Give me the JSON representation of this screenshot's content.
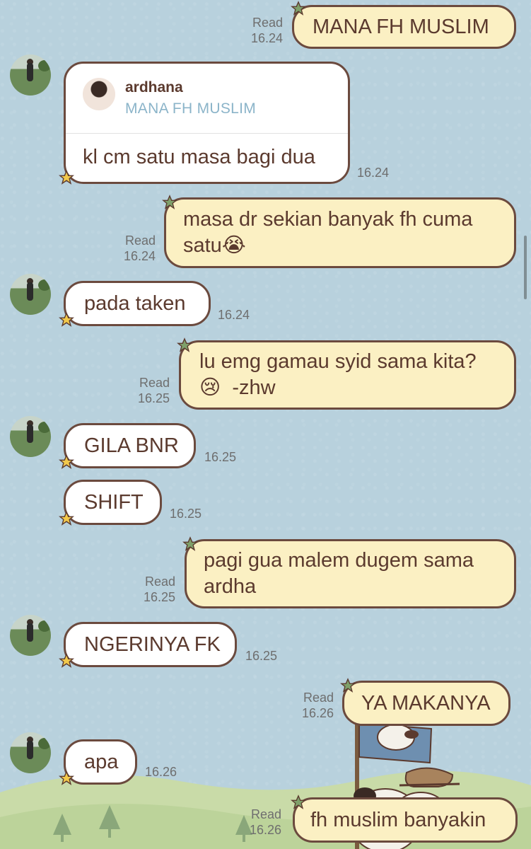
{
  "colors": {
    "background": "#b8d1dd",
    "incoming_bubble": "#ffffff",
    "outgoing_bubble": "#fbf0c3",
    "bubble_border": "#6b4a3e",
    "text": "#5b3a2e",
    "reply_quote": "#8bb4c9"
  },
  "read_label": "Read",
  "messages": [
    {
      "side": "out",
      "text": "MANA FH MUSLIM",
      "read": "Read",
      "time": "16.24"
    },
    {
      "side": "in",
      "reply": {
        "name": "ardhana",
        "quote": "MANA FH MUSLIM"
      },
      "text": "kl cm satu masa bagi dua",
      "time": "16.24"
    },
    {
      "side": "out",
      "text": "masa dr sekian banyak fh cuma\nsatu😭",
      "read": "Read",
      "time": "16.24"
    },
    {
      "side": "in",
      "text": "pada taken",
      "time": "16.24"
    },
    {
      "side": "out",
      "text": "lu emg gamau syid sama kita?\n😢  -zhw",
      "read": "Read",
      "time": "16.25"
    },
    {
      "side": "in",
      "text": "GILA BNR",
      "time": "16.25"
    },
    {
      "side": "in",
      "text": "SHIFT",
      "time": "16.25"
    },
    {
      "side": "out",
      "text": "pagi gua malem dugem sama\nardha",
      "read": "Read",
      "time": "16.25"
    },
    {
      "side": "in",
      "text": "NGERINYA FK",
      "time": "16.25"
    },
    {
      "side": "out",
      "text": "YA MAKANYA",
      "read": "Read",
      "time": "16.26"
    },
    {
      "side": "in",
      "text": "apa",
      "time": "16.26"
    },
    {
      "side": "out",
      "text": "fh muslim banyakin",
      "read": "Read",
      "time": "16.26"
    }
  ],
  "icons": {
    "star": "star-icon",
    "avatar": "contact-avatar",
    "sticker": "snoopy-sticker"
  }
}
